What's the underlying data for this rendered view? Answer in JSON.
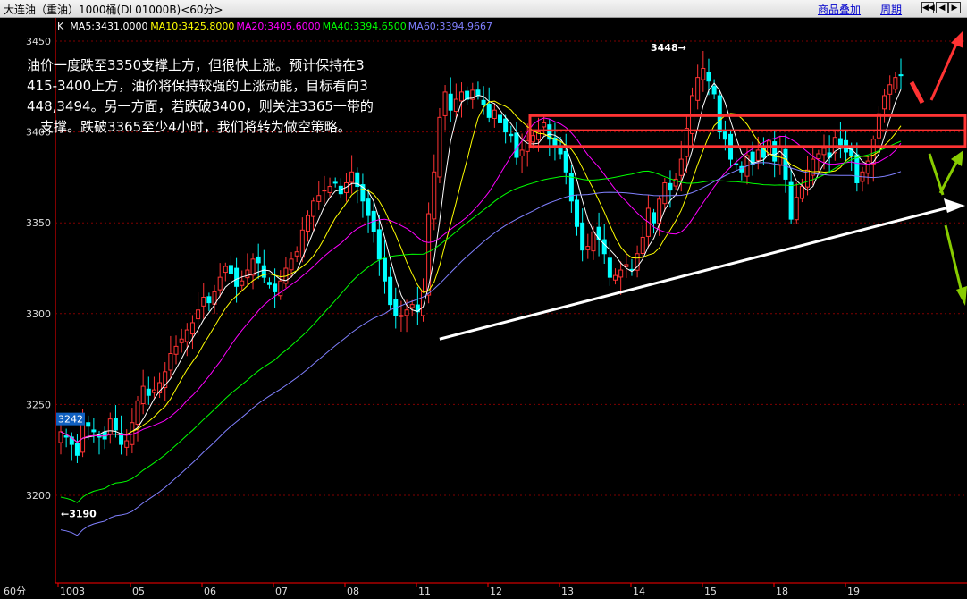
{
  "window": {
    "title": "大连油（重油）1000桶(DL01000B)<60分>",
    "buttons": [
      "商品叠加",
      "周期"
    ],
    "nav_icons": [
      "left-arrows-icon",
      "left-arrow-icon",
      "right-arrow-icon",
      "right-arrows-icon"
    ]
  },
  "ma_legend": [
    {
      "label": "K",
      "color": "#ffffff"
    },
    {
      "label": "MA5:3431.0000",
      "color": "#ffffff"
    },
    {
      "label": "MA10:3425.8000",
      "color": "#ffff00"
    },
    {
      "label": "MA20:3405.6000",
      "color": "#ff00ff"
    },
    {
      "label": "MA40:3394.6500",
      "color": "#00ff00"
    },
    {
      "label": "MA60:3394.9667",
      "color": "#8080ff"
    }
  ],
  "annotation": {
    "line1": "油价一度跌至3350支撑上方，但很快上涨。预计保持在3",
    "line2": "415-3400上方，油价将保持较强的上涨动能，目标看向3",
    "line3": "448,3494。另一方面，若跌破3400，则关注3365一带的",
    "line4": "支撑。跌破3365至少4小时，我们将转为做空策略。"
  },
  "colors": {
    "up": "#00ffff",
    "down": "#ff3333",
    "axis": "#ff0000",
    "grid": "#800000",
    "text": "#dddddd"
  },
  "chart_data": {
    "type": "candlestick",
    "period": "60分",
    "ylim": [
      3160,
      3460
    ],
    "y_ticks": [
      3200,
      3250,
      3300,
      3350,
      3400,
      3450
    ],
    "x_labels": [
      "1003",
      "05",
      "06",
      "07",
      "08",
      "11",
      "12",
      "13",
      "14",
      "15",
      "18",
      "19"
    ],
    "close": [
      3235,
      3232,
      3228,
      3222,
      3240,
      3238,
      3235,
      3232,
      3231,
      3242,
      3236,
      3228,
      3230,
      3240,
      3252,
      3260,
      3255,
      3258,
      3262,
      3268,
      3278,
      3282,
      3286,
      3291,
      3295,
      3302,
      3309,
      3306,
      3312,
      3320,
      3326,
      3322,
      3315,
      3318,
      3324,
      3330,
      3328,
      3320,
      3316,
      3312,
      3318,
      3325,
      3330,
      3334,
      3346,
      3354,
      3362,
      3365,
      3368,
      3370,
      3372,
      3366,
      3372,
      3378,
      3370,
      3362,
      3354,
      3345,
      3330,
      3318,
      3305,
      3299,
      3299,
      3302,
      3305,
      3301,
      3312,
      3355,
      3378,
      3408,
      3422,
      3412,
      3418,
      3422,
      3418,
      3423,
      3420,
      3415,
      3408,
      3412,
      3405,
      3400,
      3398,
      3386,
      3390,
      3395,
      3398,
      3400,
      3405,
      3396,
      3392,
      3388,
      3378,
      3362,
      3348,
      3335,
      3337,
      3345,
      3341,
      3333,
      3320,
      3321,
      3324,
      3327,
      3324,
      3333,
      3342,
      3358,
      3350,
      3363,
      3372,
      3368,
      3374,
      3385,
      3402,
      3420,
      3430,
      3435,
      3428,
      3421,
      3400,
      3396,
      3385,
      3382,
      3378,
      3387,
      3382,
      3390,
      3386,
      3395,
      3384,
      3392,
      3374,
      3352,
      3364,
      3370,
      3379,
      3385,
      3388,
      3391,
      3386,
      3397,
      3393,
      3389,
      3387,
      3372,
      3378,
      3384,
      3396,
      3410,
      3420,
      3426,
      3430,
      3431
    ],
    "annotations": [
      {
        "text": "3448",
        "mark": "high"
      },
      {
        "text": "3190",
        "mark": "low"
      },
      {
        "text": "3242",
        "mark": "first-price-tag"
      }
    ],
    "series": [
      {
        "name": "MA5",
        "color": "#ffffff",
        "last": 3431.0
      },
      {
        "name": "MA10",
        "color": "#ffff00",
        "last": 3425.8
      },
      {
        "name": "MA20",
        "color": "#ff00ff",
        "last": 3405.6
      },
      {
        "name": "MA40",
        "color": "#00ff00",
        "last": 3394.65
      },
      {
        "name": "MA60",
        "color": "#8080ff",
        "last": 3394.9667
      }
    ],
    "markup": {
      "resistance_zone": [
        3393,
        3409
      ],
      "trendline": [
        {
          "bar": 69,
          "price": 3286
        },
        {
          "bar": 152,
          "price": 3360
        }
      ],
      "arrows": [
        "up-red",
        "up-green",
        "down-green"
      ]
    }
  }
}
